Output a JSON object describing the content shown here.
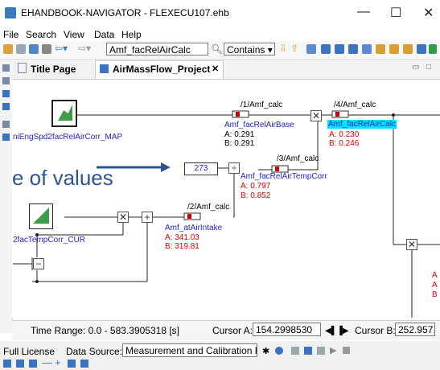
{
  "window": {
    "title": "EHANDBOOK-NAVIGATOR - FLEXECU107.ehb",
    "minimize": "—",
    "maximize": "☐",
    "close": "✕"
  },
  "menu": [
    "File",
    "Search",
    "View",
    "Data",
    "Help"
  ],
  "toolbar": {
    "search_value": "Amf_facRelAirCalc",
    "match_mode": "Contains"
  },
  "tabs": [
    {
      "label": "Title Page"
    },
    {
      "label": "AirMassFlow_Project",
      "close": "✕"
    }
  ],
  "diagram": {
    "left_map": "niEngSpd2facRelAirCorr_MAP",
    "left_curve": "2facTempCorr_CUR",
    "overlay_text": "e of values",
    "const_value": "273",
    "calc_labels": [
      "/1/Amf_calc",
      "/4/Amf_calc",
      "/3/Amf_calc",
      "/2/Amf_calc"
    ],
    "signals": [
      {
        "name": "Amf_facRelAirBase",
        "a": "A: 0.291",
        "b": "B: 0.291"
      },
      {
        "name": "Amf_facRelAirCalc",
        "a": "A: 0.230",
        "b": "B: 0.246"
      },
      {
        "name": "Amf_facRelAirTempCorr",
        "a": "A: 0.797",
        "b": "B: 0.852"
      },
      {
        "name": "Amf_atAirIntake",
        "a": "A: 341.03",
        "b": "B: 319.81"
      }
    ],
    "edge_letters": [
      "A",
      "A",
      "B"
    ]
  },
  "status": {
    "time_range": "Time Range: 0.0 - 583.3905318 [s]",
    "cursor_a_label": "Cursor A:",
    "cursor_a_value": "154.2998530",
    "cursor_b_label": "Cursor B:",
    "cursor_b_value": "252.9571716"
  },
  "footer": {
    "license": "Full License",
    "data_source_label": "Data Source:",
    "data_source_value": "Measurement and Calibration Files"
  }
}
